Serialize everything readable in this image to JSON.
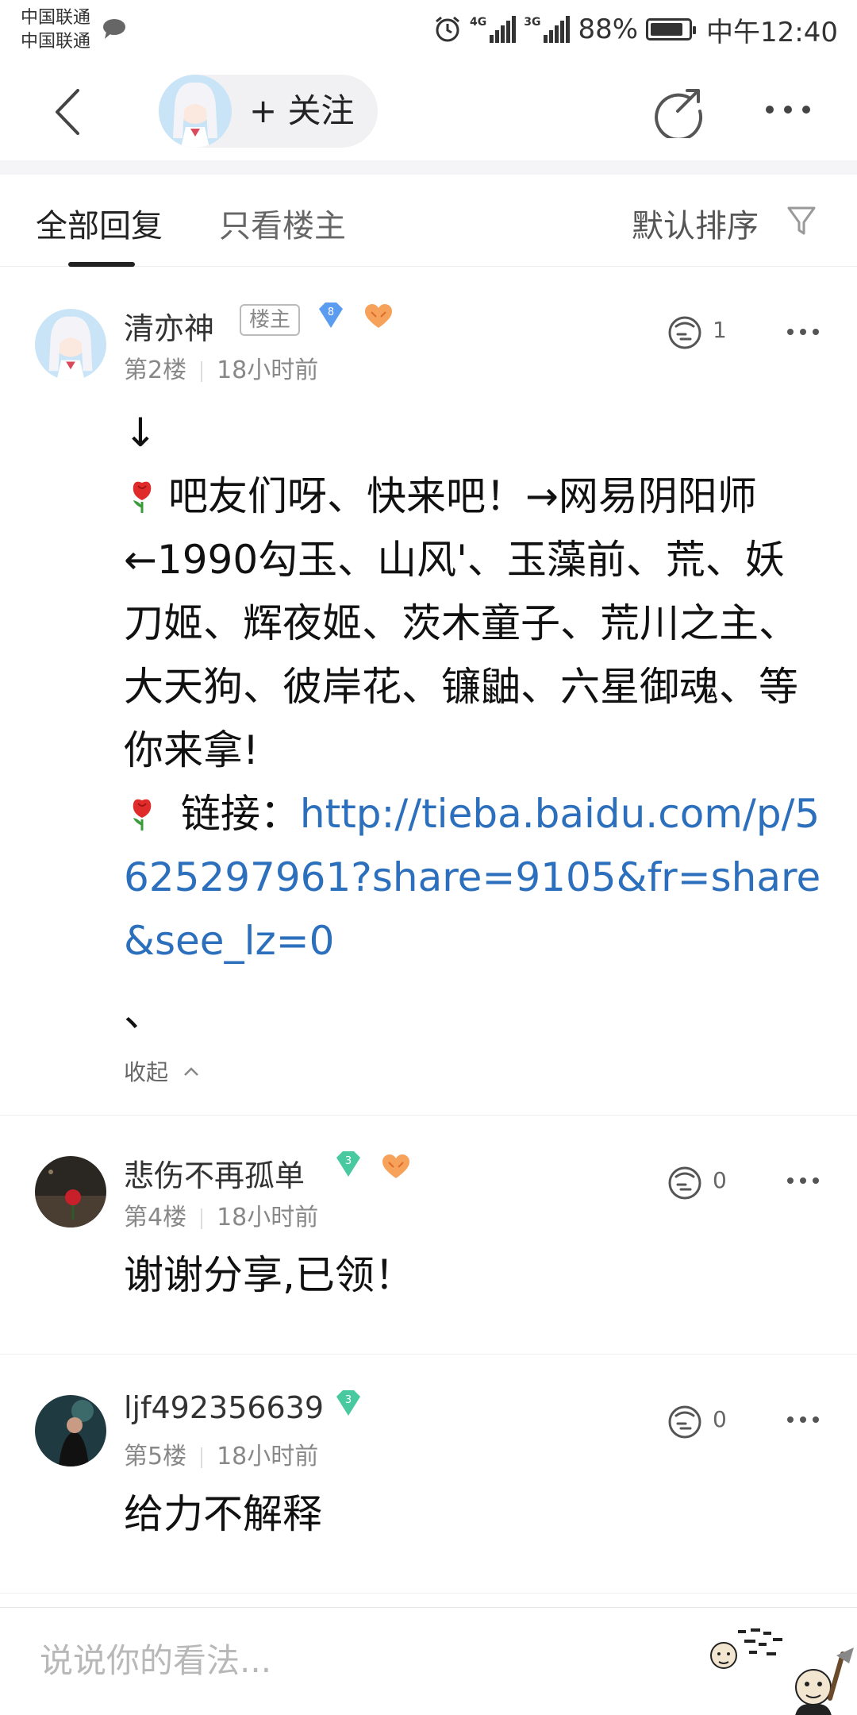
{
  "status_bar": {
    "carrier1": "中国联通",
    "carrier2": "中国联通",
    "network1": "4G",
    "network2": "3G",
    "battery": "88%",
    "battery_level": 0.88,
    "time": "中午12:40"
  },
  "nav": {
    "follow_label": "+ 关注"
  },
  "tabs": {
    "all_replies": "全部回复",
    "only_lz": "只看楼主",
    "sort": "默认排序"
  },
  "posts": [
    {
      "username": "清亦神",
      "badge": "楼主",
      "level": "8",
      "floor": "第2楼",
      "time": "18小时前",
      "likes": "1",
      "content": {
        "line0": "↓",
        "text1": "吧友们呀、快来吧！→网易阴阳师←1990勾玉、山风'、玉藻前、荒、妖刀姬、辉夜姬、茨木童子、荒川之主、大天狗、彼岸花、镰鼬、六星御魂、等你来拿!",
        "link_label": " 链接：",
        "link": "http://tieba.baidu.com/p/5625297961?share=9105&fr=share&see_lz=0",
        "trail": "、"
      },
      "collapse": "收起"
    },
    {
      "username": "悲伤不再孤单",
      "level": "3",
      "floor": "第4楼",
      "time": "18小时前",
      "likes": "0",
      "content": "谢谢分享,已领！"
    },
    {
      "username": "ljf492356639",
      "level": "3",
      "floor": "第5楼",
      "time": "18小时前",
      "likes": "0",
      "content": "给力不解释"
    }
  ],
  "reply_bar": {
    "placeholder": "说说你的看法..."
  },
  "colors": {
    "link": "#2c6fbd",
    "level_blue": "#5b9cf0",
    "level_green": "#48c9a0"
  }
}
